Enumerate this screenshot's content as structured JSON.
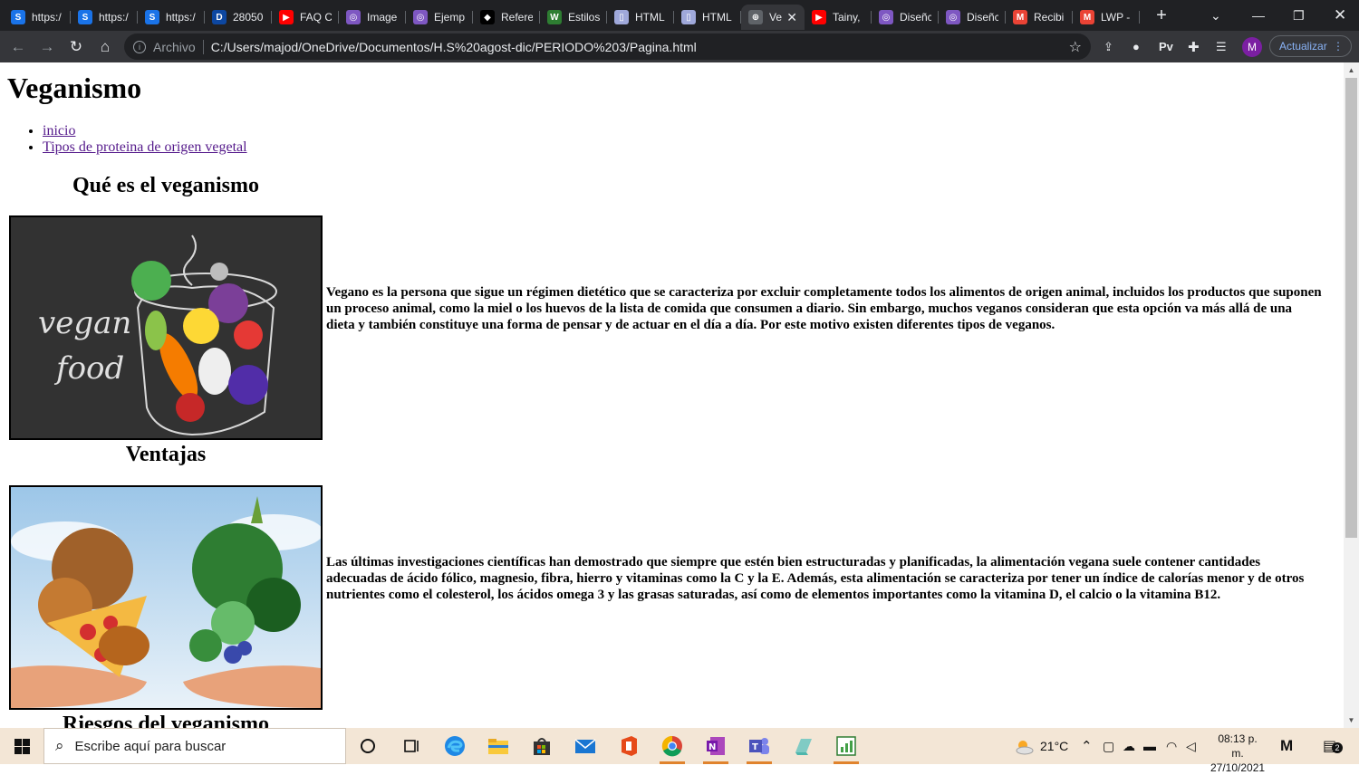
{
  "browser": {
    "tabs": [
      {
        "label": "https:/",
        "favicon_color": "#1a73e8",
        "favicon_text": "S",
        "active": false
      },
      {
        "label": "https:/",
        "favicon_color": "#1a73e8",
        "favicon_text": "S",
        "active": false
      },
      {
        "label": "https:/",
        "favicon_color": "#1a73e8",
        "favicon_text": "S",
        "active": false
      },
      {
        "label": "28050",
        "favicon_color": "#0d47a1",
        "favicon_text": "D",
        "active": false
      },
      {
        "label": "FAQ C",
        "favicon_color": "#ff0000",
        "favicon_text": "▶",
        "active": false
      },
      {
        "label": "Image",
        "favicon_color": "#7e57c2",
        "favicon_text": "◎",
        "active": false
      },
      {
        "label": "Ejemp",
        "favicon_color": "#7e57c2",
        "favicon_text": "◎",
        "active": false
      },
      {
        "label": "Refere",
        "favicon_color": "#000000",
        "favicon_text": "◆",
        "active": false
      },
      {
        "label": "Estilos",
        "favicon_color": "#2e7d32",
        "favicon_text": "W",
        "active": false
      },
      {
        "label": "HTML",
        "favicon_color": "#9fa8da",
        "favicon_text": "▯",
        "active": false
      },
      {
        "label": "HTML",
        "favicon_color": "#9fa8da",
        "favicon_text": "▯",
        "active": false
      },
      {
        "label": "Ve",
        "favicon_color": "#5f6368",
        "favicon_text": "⊕",
        "active": true
      },
      {
        "label": "Tainy,",
        "favicon_color": "#ff0000",
        "favicon_text": "▶",
        "active": false
      },
      {
        "label": "Diseñc",
        "favicon_color": "#7e57c2",
        "favicon_text": "◎",
        "active": false
      },
      {
        "label": "Diseñc",
        "favicon_color": "#7e57c2",
        "favicon_text": "◎",
        "active": false
      },
      {
        "label": "Recibi",
        "favicon_color": "#ea4335",
        "favicon_text": "M",
        "active": false
      },
      {
        "label": "LWP -",
        "favicon_color": "#ea4335",
        "favicon_text": "M",
        "active": false
      }
    ],
    "address": {
      "scheme": "Archivo",
      "url": "C:/Users/majod/OneDrive/Documentos/H.S%20agost-dic/PERIODO%203/Pagina.html"
    },
    "extension_label": "Pv",
    "avatar_letter": "M",
    "update_label": "Actualizar"
  },
  "page": {
    "title": "Veganismo",
    "nav": [
      {
        "label": "inicio"
      },
      {
        "label": "Tipos de proteina de origen vegetal"
      }
    ],
    "sections": [
      {
        "heading": "Qué es el veganismo",
        "text": "Vegano es la persona que sigue un régimen dietético que se caracteriza por excluir completamente todos los alimentos de origen animal, incluidos los productos que suponen un proceso animal, como la miel o los huevos de la lista de comida que consumen a diario. Sin embargo, muchos veganos consideran que esta opción va más allá de una dieta y también constituye una forma de pensar y de actuar en el día a día. Por este motivo existen diferentes tipos de veganos."
      },
      {
        "heading": "Ventajas",
        "text": "Las últimas investigaciones científicas han demostrado que siempre que estén bien estructuradas y planificadas, la alimentación vegana suele contener cantidades adecuadas de ácido fólico, magnesio, fibra, hierro y vitaminas como la C y la E. Además, esta alimentación se caracteriza por tener un índice de calorías menor y de otros nutrientes como el colesterol, los ácidos omega 3 y las grasas saturadas, así como de elementos importantes como la vitamina D, el calcio o la vitamina B12."
      },
      {
        "heading": "Riesgos del veganismo"
      }
    ],
    "image1_text": [
      "vegan",
      "food"
    ]
  },
  "taskbar": {
    "search_placeholder": "Escribe aquí para buscar",
    "weather": "21°C",
    "time": "08:13 p. m.",
    "date": "27/10/2021",
    "notification_count": "2"
  }
}
